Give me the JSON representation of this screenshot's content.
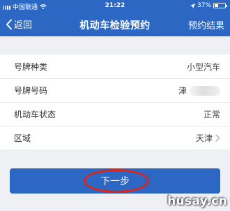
{
  "status_bar": {
    "carrier": "中国联通",
    "time": "21:22",
    "battery": "37%",
    "battery_level": 0.37
  },
  "nav": {
    "back_label": "返回",
    "title": "机动车检验预约",
    "right_label": "预约结果"
  },
  "form": {
    "rows": [
      {
        "label": "号牌种类",
        "value": "小型汽车"
      },
      {
        "label": "号牌号码",
        "value": "津"
      },
      {
        "label": "机动车状态",
        "value": "正常"
      },
      {
        "label": "区域",
        "value": "天津"
      }
    ]
  },
  "actions": {
    "next_label": "下一步"
  },
  "watermark": "husay.cn",
  "colors": {
    "accent": "#2b67c3",
    "highlight": "#d9251d",
    "background": "#eef0f4"
  }
}
